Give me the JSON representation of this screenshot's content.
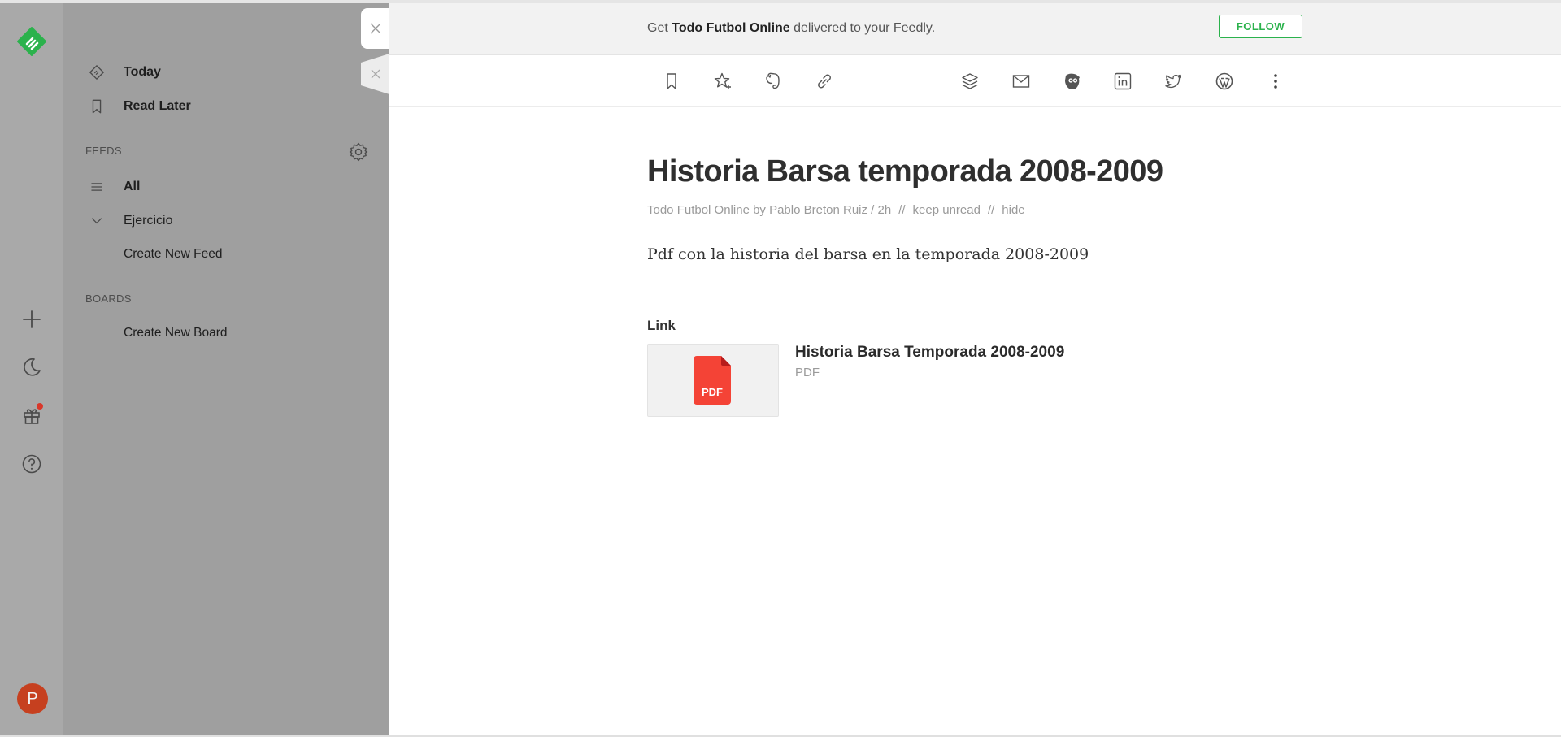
{
  "app": {
    "title": "Feedly"
  },
  "rail": {
    "logo": "feedly-logo",
    "buttons": [
      "add-icon",
      "moon-icon",
      "gift-icon",
      "help-icon"
    ],
    "avatar_initial": "P",
    "avatar_color": "#c6401f"
  },
  "sidebar": {
    "today_label": "Today",
    "read_later_label": "Read Later",
    "feeds_heading": "FEEDS",
    "all_label": "All",
    "folder_label": "Ejercicio",
    "create_feed_label": "Create New Feed",
    "boards_heading": "BOARDS",
    "create_board_label": "Create New Board"
  },
  "banner": {
    "prefix": "Get ",
    "source": "Todo Futbol Online",
    "suffix": " delivered to your Feedly.",
    "follow_label": "FOLLOW",
    "accent_color": "#2bb24c"
  },
  "toolbar": {
    "actions": [
      "bookmark-icon",
      "star-icon",
      "evernote-icon",
      "link-icon",
      "buffer-icon",
      "mail-icon",
      "hootsuite-icon",
      "linkedin-icon",
      "twitter-icon",
      "wordpress-icon",
      "more-icon"
    ]
  },
  "article": {
    "title": "Historia Barsa temporada 2008-2009",
    "byline": "Todo Futbol Online by Pablo Breton Ruiz / 2h",
    "separator": "//",
    "keep_unread": "keep unread",
    "hide": "hide",
    "summary": "Pdf con la historia del barsa en la temporada 2008-2009",
    "link_heading": "Link",
    "attachment": {
      "title": "Historia Barsa Temporada 2008-2009",
      "type": "PDF",
      "icon_label": "PDF",
      "icon_color": "#f44336"
    }
  }
}
